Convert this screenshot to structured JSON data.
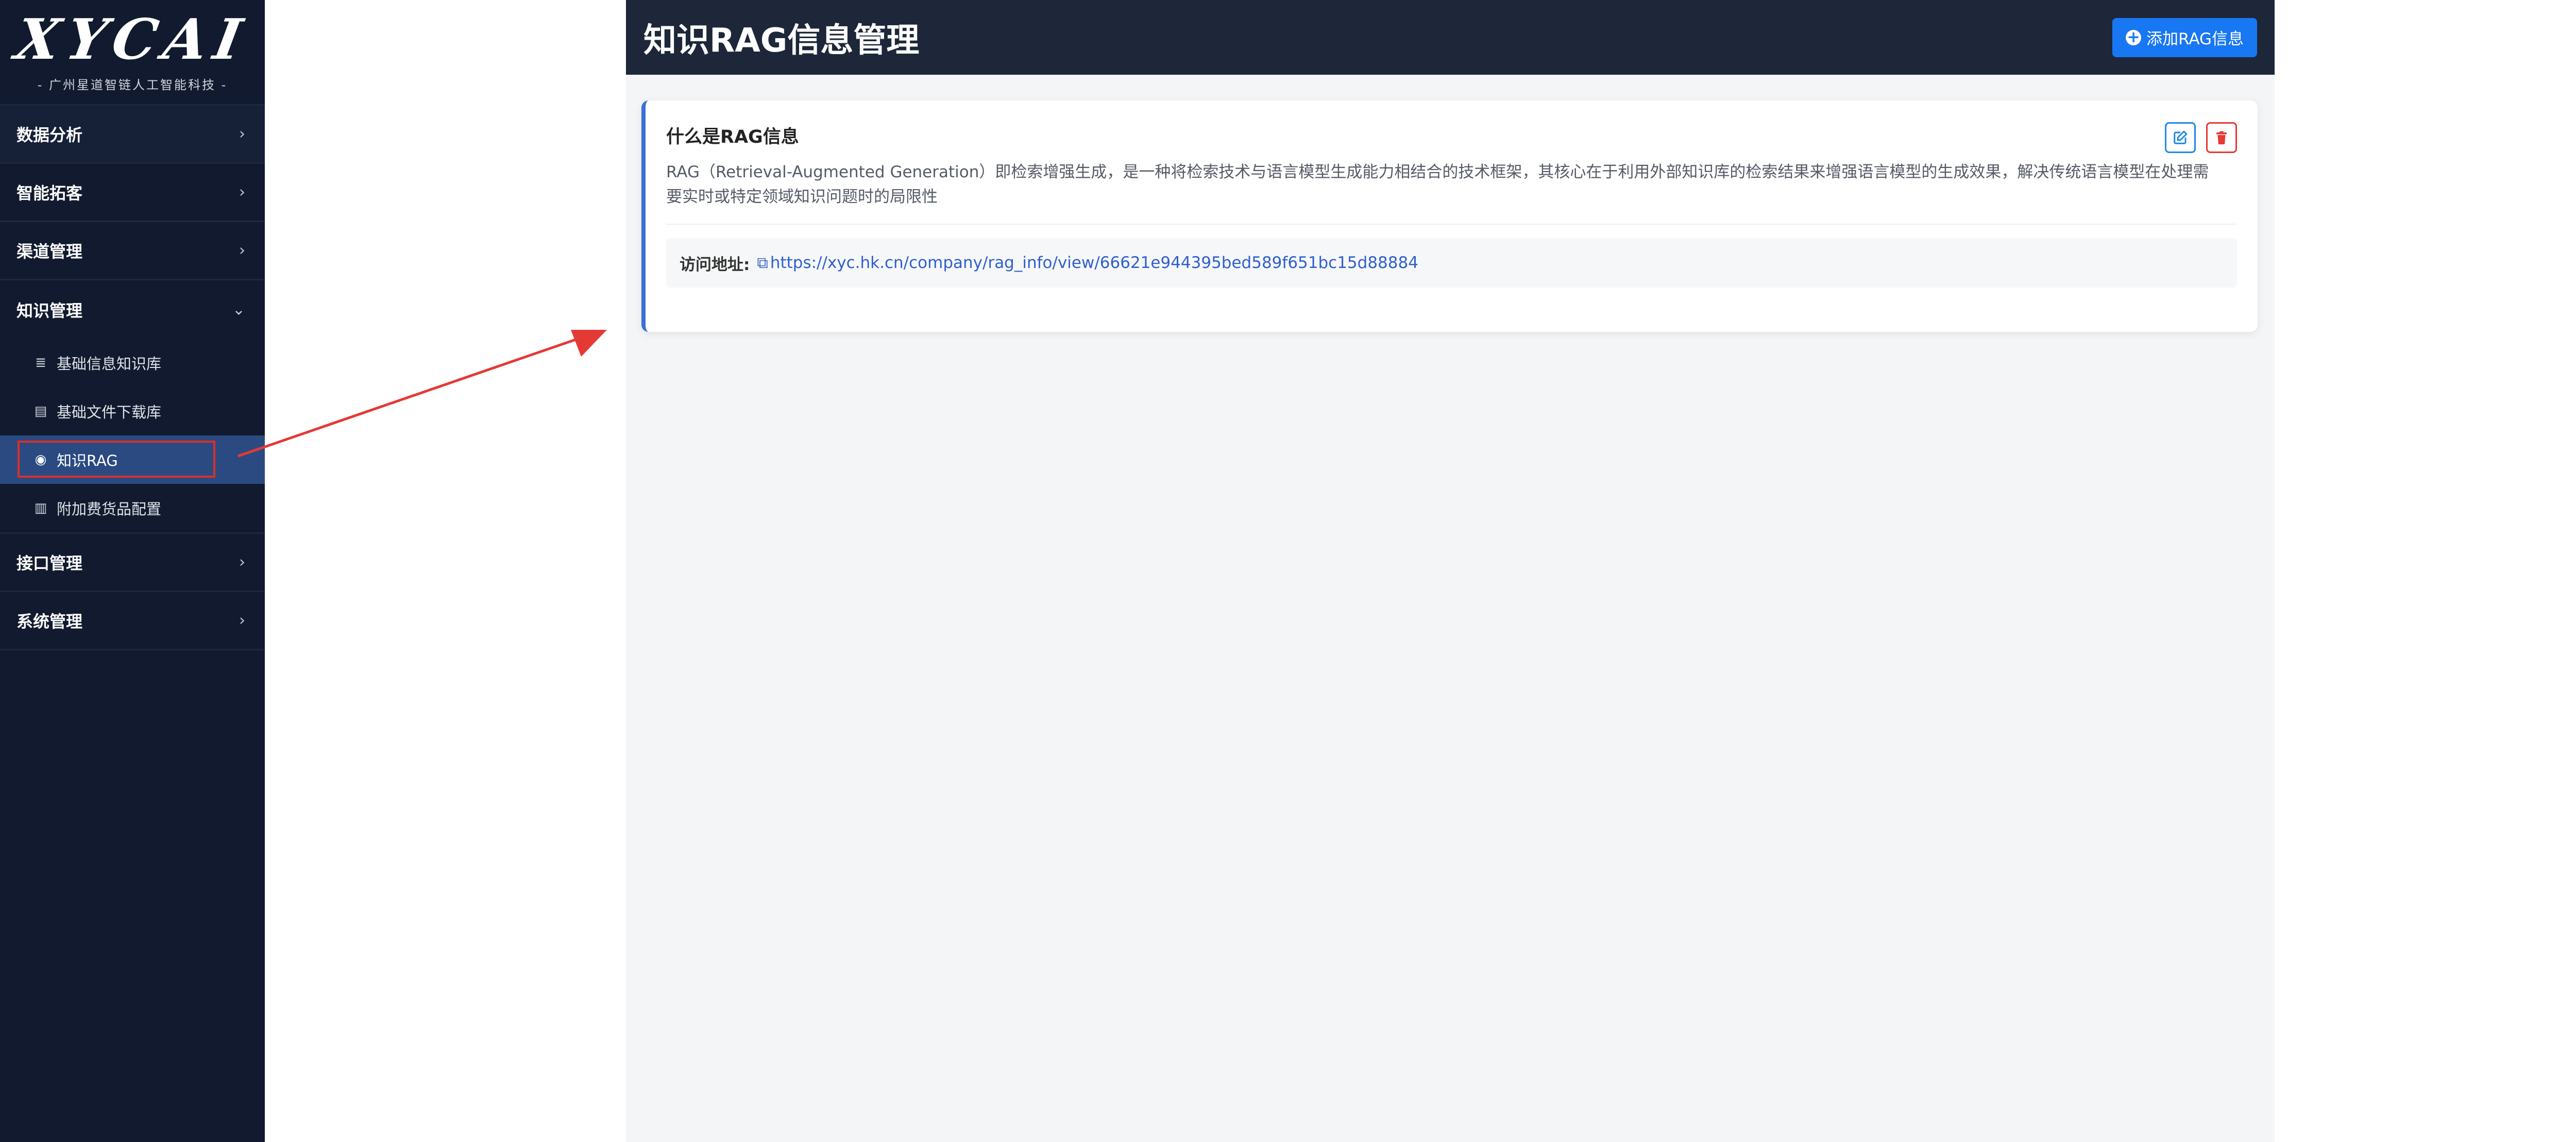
{
  "sidebar": {
    "logo_text": "XYCAI",
    "logo_subtitle": "- 广州星道智链人工智能科技 -",
    "items": [
      {
        "label": "数据分析",
        "chevron": "›"
      },
      {
        "label": "智能拓客",
        "chevron": "›"
      },
      {
        "label": "渠道管理",
        "chevron": "›"
      },
      {
        "label": "知识管理",
        "chevron": "⌄"
      },
      {
        "label": "接口管理",
        "chevron": "›"
      },
      {
        "label": "系统管理",
        "chevron": "›"
      }
    ],
    "sub_items": [
      {
        "label": "基础信息知识库",
        "icon": "database-icon",
        "glyph": "≣"
      },
      {
        "label": "基础文件下载库",
        "icon": "file-icon",
        "glyph": "▤"
      },
      {
        "label": "知识RAG",
        "icon": "brain-icon",
        "glyph": "◉",
        "active": true
      },
      {
        "label": "附加费货品配置",
        "icon": "luggage-icon",
        "glyph": "▥"
      }
    ]
  },
  "header": {
    "title": "知识RAG信息管理",
    "add_button_label": "添加RAG信息",
    "add_icon_glyph": "+"
  },
  "card": {
    "title": "什么是RAG信息",
    "description": "RAG（Retrieval-Augmented Generation）即检索增强生成，是一种将检索技术与语言模型生成能力相结合的技术框架，其核心在于利用外部知识库的检索结果来增强语言模型的生成效果，解决传统语言模型在处理需要实时或特定领域知识问题时的局限性",
    "link_label": "访问地址:",
    "link_url": "https://xyc.hk.cn/company/rag_info/view/66621e944395bed589f651bc15d88884",
    "link_icon_glyph": "⧉"
  },
  "colors": {
    "sidebar_bg": "#111a2e",
    "active_item": "#2b4a82",
    "header_bg": "#1d2739",
    "primary_button": "#1877f2",
    "card_accent": "#3c6fd8",
    "edit": "#1e88e5",
    "delete": "#e53935",
    "annotation": "#e53935"
  }
}
